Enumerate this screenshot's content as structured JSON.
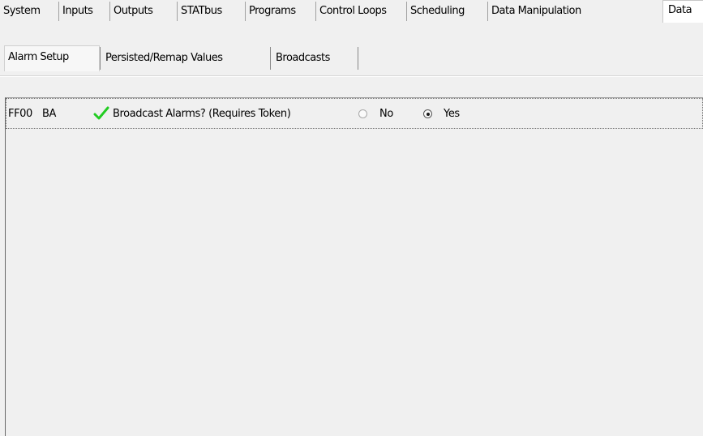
{
  "top_tabs": [
    {
      "label": "System"
    },
    {
      "label": "Inputs"
    },
    {
      "label": "Outputs"
    },
    {
      "label": "STATbus"
    },
    {
      "label": "Programs"
    },
    {
      "label": "Control Loops"
    },
    {
      "label": "Scheduling"
    },
    {
      "label": "Data Manipulation"
    },
    {
      "label": "Data"
    }
  ],
  "sub_tabs": [
    {
      "label": "Alarm Setup"
    },
    {
      "label": "Persisted/Remap Values"
    },
    {
      "label": "Broadcasts"
    }
  ],
  "alarm_row": {
    "address": "FF00",
    "code": "BA",
    "status_icon": "check-icon",
    "status_color": "#22cc22",
    "question": "Broadcast Alarms? (Requires Token)",
    "option_no": "No",
    "option_yes": "Yes",
    "selected": "Yes"
  }
}
